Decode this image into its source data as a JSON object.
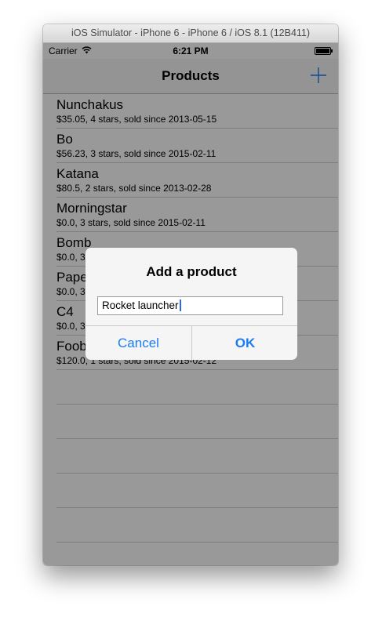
{
  "window": {
    "title": "iOS Simulator - iPhone 6 - iPhone 6 / iOS 8.1 (12B411)"
  },
  "status_bar": {
    "carrier": "Carrier",
    "time": "6:21 PM"
  },
  "nav_bar": {
    "title": "Products",
    "add_icon": "plus-icon"
  },
  "products": [
    {
      "name": "Nunchakus",
      "details": "$35.05, 4 stars, sold since 2013-05-15"
    },
    {
      "name": "Bo",
      "details": "$56.23, 3 stars, sold since 2015-02-11"
    },
    {
      "name": "Katana",
      "details": "$80.5, 2 stars, sold since 2013-02-28"
    },
    {
      "name": "Morningstar",
      "details": "$0.0, 3 stars, sold since 2015-02-11"
    },
    {
      "name": "Bomb",
      "details": "$0.0, 3"
    },
    {
      "name": "Pape",
      "details": "$0.0, 3"
    },
    {
      "name": "C4",
      "details": "$0.0, 3"
    },
    {
      "name": "Foob",
      "details": "$120.0, 1 stars, sold since 2015-02-12"
    }
  ],
  "alert": {
    "title": "Add a product",
    "input_value": "Rocket launcher",
    "cancel_label": "Cancel",
    "ok_label": "OK"
  },
  "colors": {
    "accent": "#1a7cf2",
    "overlay": "#000000"
  }
}
